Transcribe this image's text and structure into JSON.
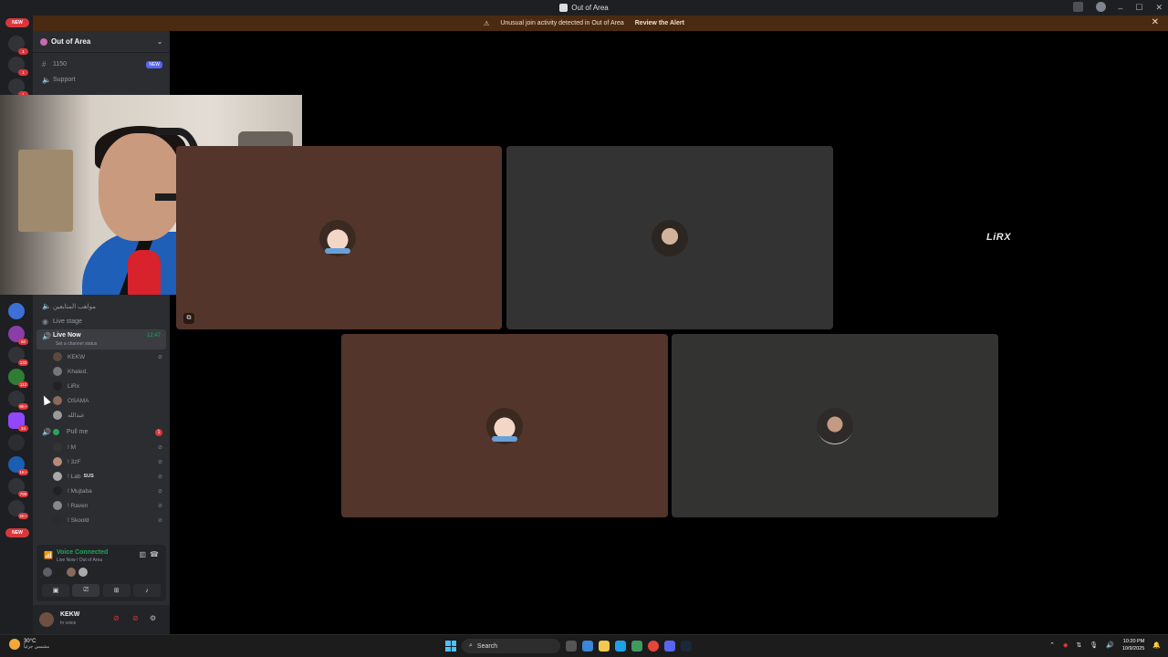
{
  "window": {
    "title": "Out of Area"
  },
  "banner": {
    "text": "Unusual join activity detected in Out of Area",
    "link": "Review the Alert"
  },
  "rail": {
    "new_top": "NEW",
    "new_bottom": "NEW",
    "badges": [
      "1",
      "1",
      "1",
      "60",
      "132",
      "112",
      "9K+",
      "34",
      "1K+",
      "799",
      "2K+"
    ]
  },
  "sidebar": {
    "server_name": "Out of Area",
    "channels_top": [
      {
        "name": "1150",
        "tag": "NEW"
      },
      {
        "name": "Support"
      }
    ],
    "channels_mid": [
      {
        "name": "مواهب المتابعين"
      },
      {
        "name": "Live stage"
      }
    ],
    "live": {
      "name": "Live Now",
      "time": "12:47",
      "status": "Set a channel status"
    },
    "live_members": [
      "KEKW",
      "Khaled.",
      "LiRx",
      "OSAMA",
      "عبدالله"
    ],
    "pull": {
      "name": "Pull me",
      "badge": "1"
    },
    "pull_members": [
      "! M",
      "! 3zF",
      "! Lab",
      "! Mujtaba",
      "! Raven",
      "! Skoold"
    ],
    "sus_tag": "SUS"
  },
  "voice": {
    "title": "Voice Connected",
    "sub": "Live Now / Out of Area"
  },
  "user": {
    "name": "KEKW",
    "status": "In voice"
  },
  "stage": {
    "logo_text": "LiRX"
  },
  "taskbar": {
    "temp": "30°C",
    "weather": "مشمس جزئياً",
    "search": "Search",
    "time": "10:20 PM",
    "date": "10/9/2025"
  }
}
